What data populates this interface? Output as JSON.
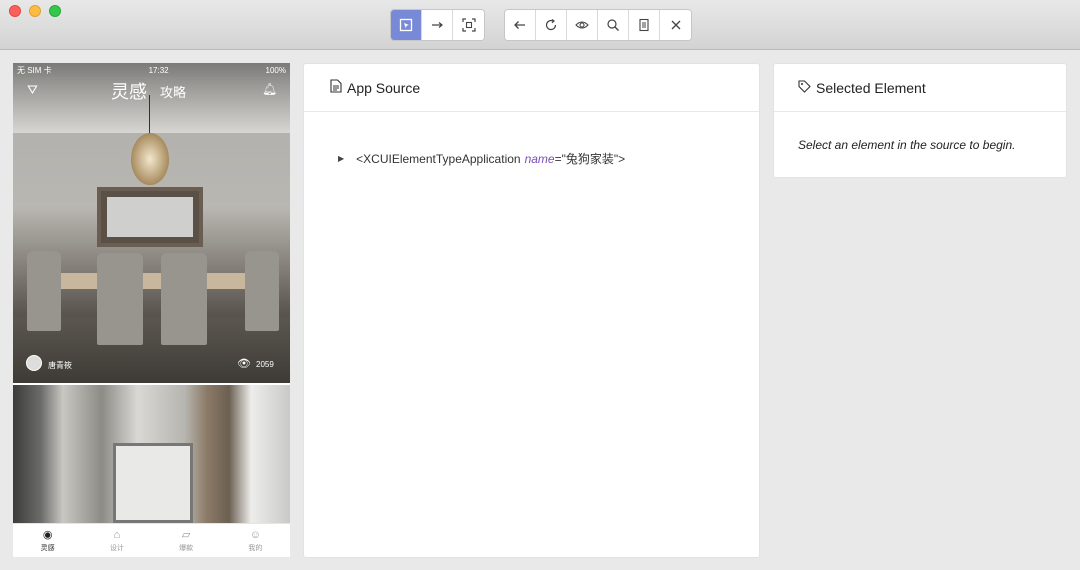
{
  "window": {
    "toolbar_group1": [
      {
        "icon": "select-element-icon",
        "active": true
      },
      {
        "icon": "swipe-arrow-icon",
        "active": false
      },
      {
        "icon": "screenshot-frame-icon",
        "active": false
      }
    ],
    "toolbar_group2": [
      {
        "icon": "back-arrow-icon"
      },
      {
        "icon": "refresh-icon"
      },
      {
        "icon": "eye-icon"
      },
      {
        "icon": "search-icon"
      },
      {
        "icon": "copy-xml-icon"
      },
      {
        "icon": "close-icon"
      }
    ]
  },
  "device": {
    "status": {
      "carrier": "无 SIM 卡",
      "time": "17:32",
      "battery": "100%"
    },
    "nav": {
      "title1": "灵感",
      "title2": "攻略"
    },
    "card": {
      "username": "唐青筱",
      "views": "2059"
    },
    "tabs": [
      {
        "label": "灵感",
        "icon": "eye-icon",
        "active": true
      },
      {
        "label": "设计",
        "icon": "home-icon",
        "active": false
      },
      {
        "label": "爆款",
        "icon": "thumbs-up-icon",
        "active": false
      },
      {
        "label": "我的",
        "icon": "smile-icon",
        "active": false
      }
    ]
  },
  "source": {
    "title": "App Source",
    "node_tag": "<XCUIElementTypeApplication",
    "attr_name": "name",
    "attr_value": "=\"兔狗家装\">"
  },
  "selected": {
    "title": "Selected Element",
    "hint": "Select an element in the source to begin."
  }
}
